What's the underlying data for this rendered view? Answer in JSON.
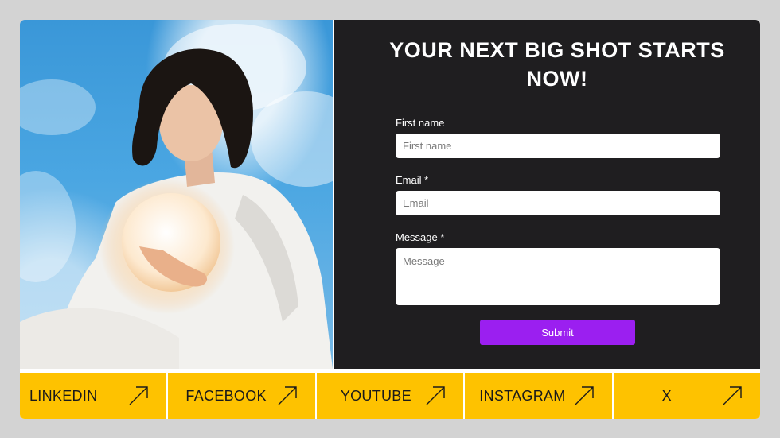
{
  "form": {
    "title": "YOUR NEXT BIG SHOT STARTS NOW!",
    "first_name_label": "First name",
    "first_name_placeholder": "First name",
    "email_label": "Email *",
    "email_placeholder": "Email",
    "message_label": "Message *",
    "message_placeholder": "Message",
    "submit_label": "Submit"
  },
  "socials": [
    {
      "label": "LINKEDIN",
      "icon": "arrow-up-right-icon"
    },
    {
      "label": "FACEBOOK",
      "icon": "arrow-up-right-icon"
    },
    {
      "label": "YOUTUBE",
      "icon": "arrow-up-right-icon"
    },
    {
      "label": "INSTAGRAM",
      "icon": "arrow-up-right-icon"
    },
    {
      "label": "X",
      "icon": "arrow-up-right-icon"
    }
  ],
  "colors": {
    "page_background": "#d3d3d3",
    "form_panel": "#1f1e20",
    "submit_button": "#9b1ff0",
    "social_bar": "#fec200"
  }
}
